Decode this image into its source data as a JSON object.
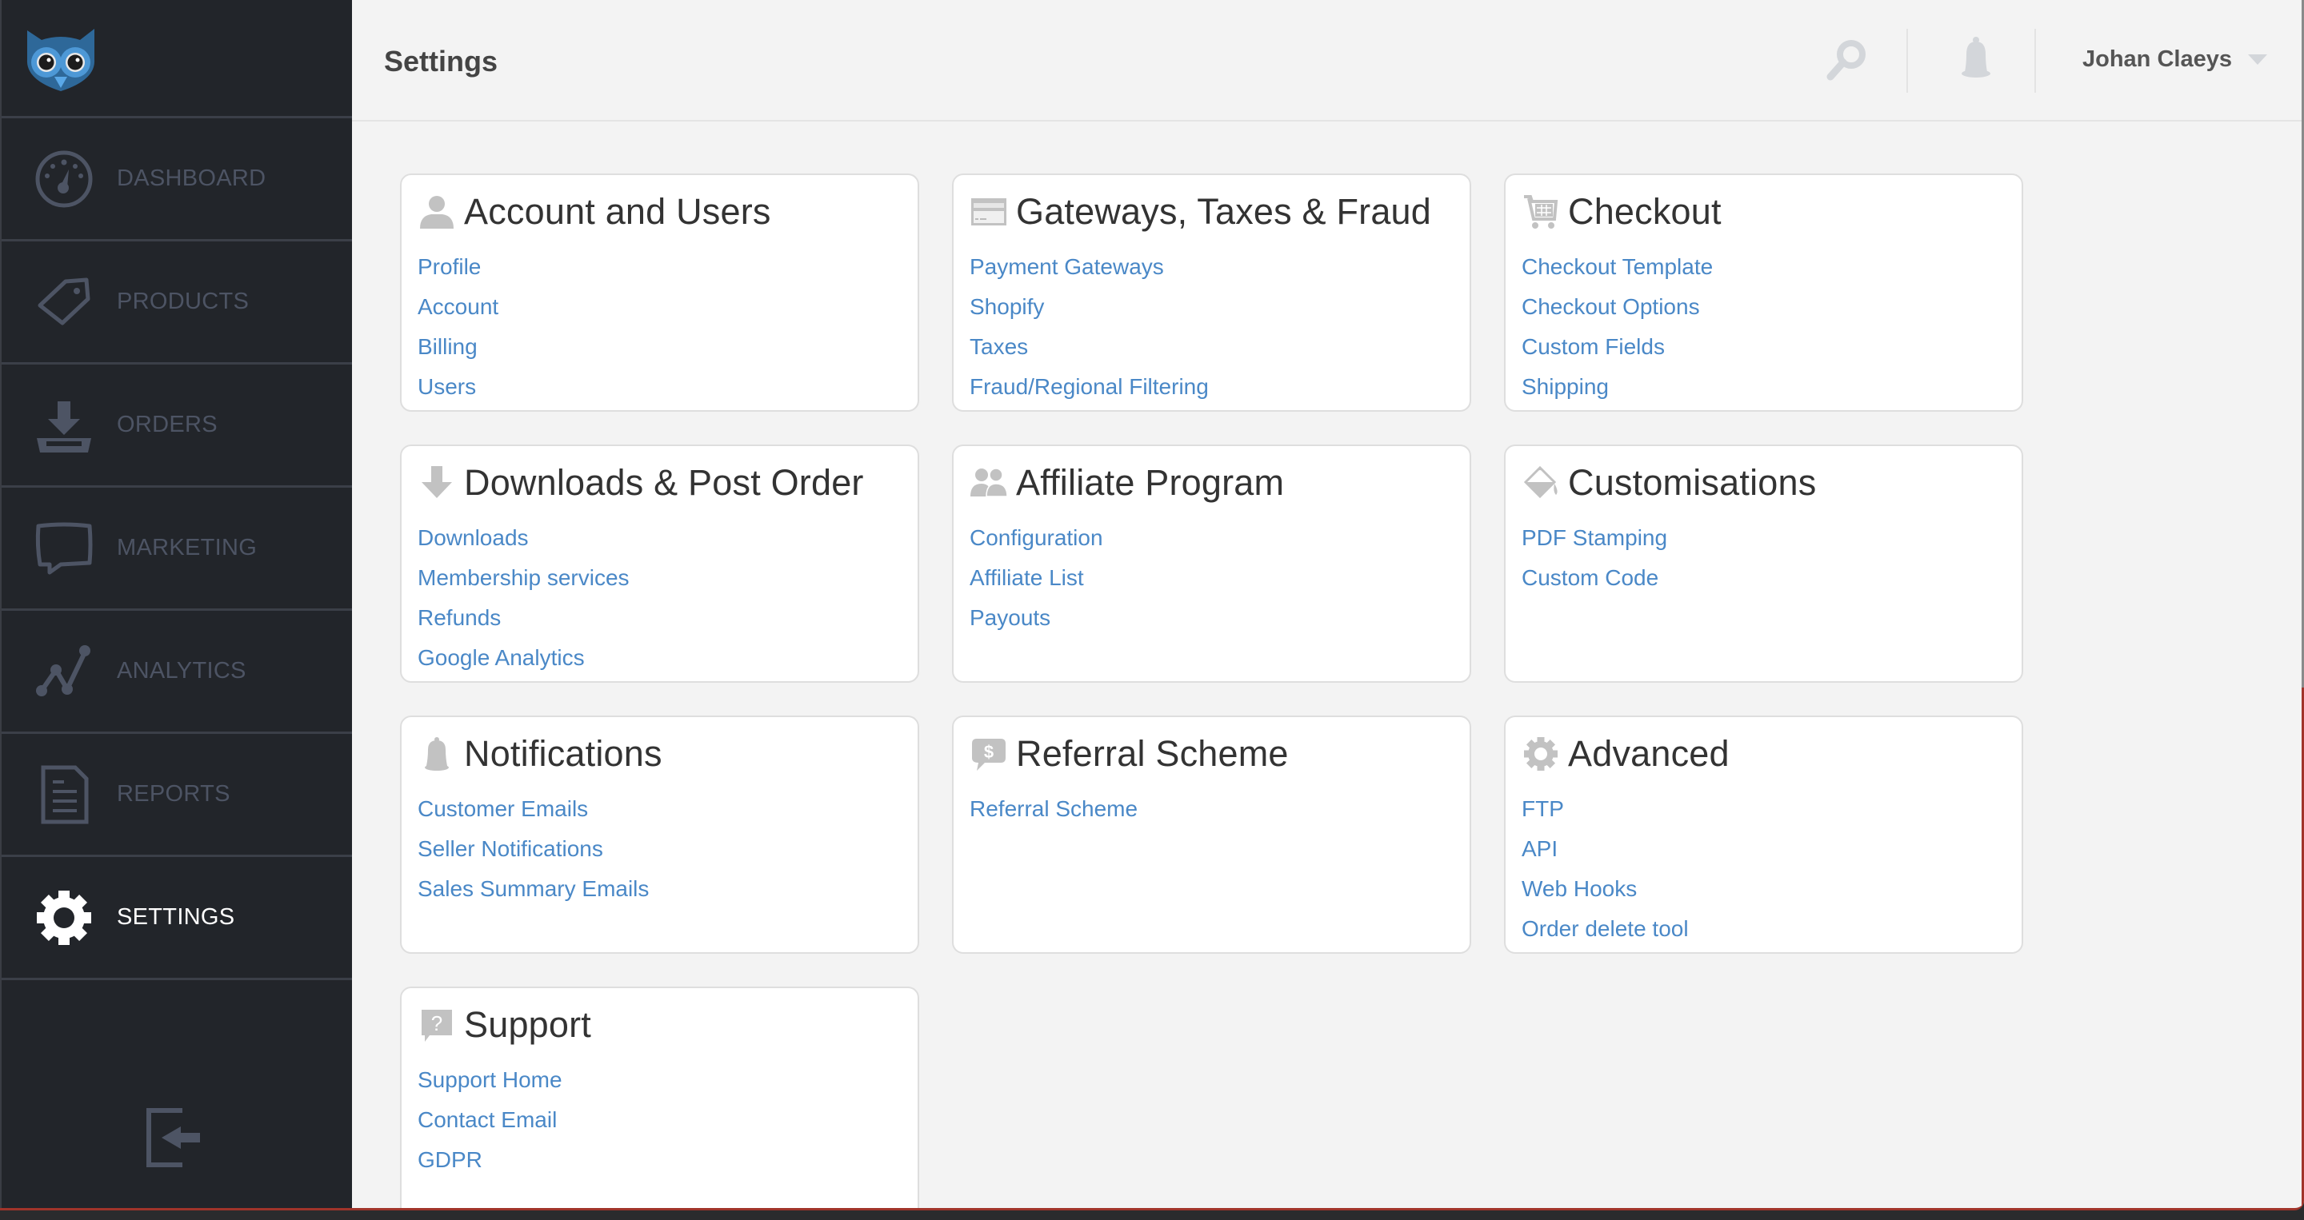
{
  "app": {
    "logo": "owl-logo"
  },
  "sidebar": {
    "items": [
      {
        "label": "DASHBOARD",
        "icon": "dashboard-gauge-icon",
        "active": false
      },
      {
        "label": "PRODUCTS",
        "icon": "tag-icon",
        "active": false
      },
      {
        "label": "ORDERS",
        "icon": "download-tray-icon",
        "active": false
      },
      {
        "label": "MARKETING",
        "icon": "speech-bubble-icon",
        "active": false
      },
      {
        "label": "ANALYTICS",
        "icon": "line-chart-icon",
        "active": false
      },
      {
        "label": "REPORTS",
        "icon": "document-icon",
        "active": false
      },
      {
        "label": "SETTINGS",
        "icon": "gear-icon",
        "active": true
      }
    ],
    "logout_icon": "logout-icon"
  },
  "header": {
    "title": "Settings",
    "search_icon": "search-icon",
    "notifications_icon": "bell-icon",
    "user_name": "Johan Claeys"
  },
  "colors": {
    "sidebar_bg": "#22252a",
    "nav_inactive": "#4d5464",
    "nav_active": "#ffffff",
    "link": "#4a88c7",
    "card_title": "#333333",
    "card_icon": "#c2c2c2"
  },
  "cards": [
    {
      "title": "Account and Users",
      "icon": "user-icon",
      "links": [
        "Profile",
        "Account",
        "Billing",
        "Users"
      ]
    },
    {
      "title": "Gateways, Taxes & Fraud",
      "icon": "credit-card-icon",
      "links": [
        "Payment Gateways",
        "Shopify",
        "Taxes",
        "Fraud/Regional Filtering"
      ]
    },
    {
      "title": "Checkout",
      "icon": "cart-icon",
      "links": [
        "Checkout Template",
        "Checkout Options",
        "Custom Fields",
        "Shipping"
      ]
    },
    {
      "title": "Downloads & Post Order",
      "icon": "download-arrow-icon",
      "links": [
        "Downloads",
        "Membership services",
        "Refunds",
        "Google Analytics"
      ]
    },
    {
      "title": "Affiliate Program",
      "icon": "users-icon",
      "links": [
        "Configuration",
        "Affiliate List",
        "Payouts"
      ]
    },
    {
      "title": "Customisations",
      "icon": "paint-bucket-icon",
      "links": [
        "PDF Stamping",
        "Custom Code"
      ]
    },
    {
      "title": "Notifications",
      "icon": "bell-icon",
      "links": [
        "Customer Emails",
        "Seller Notifications",
        "Sales Summary Emails"
      ]
    },
    {
      "title": "Referral Scheme",
      "icon": "dollar-bubble-icon",
      "links": [
        "Referral Scheme"
      ]
    },
    {
      "title": "Advanced",
      "icon": "gear-icon",
      "links": [
        "FTP",
        "API",
        "Web Hooks",
        "Order delete tool"
      ]
    },
    {
      "title": "Support",
      "icon": "question-bubble-icon",
      "links": [
        "Support Home",
        "Contact Email",
        "GDPR"
      ]
    }
  ]
}
